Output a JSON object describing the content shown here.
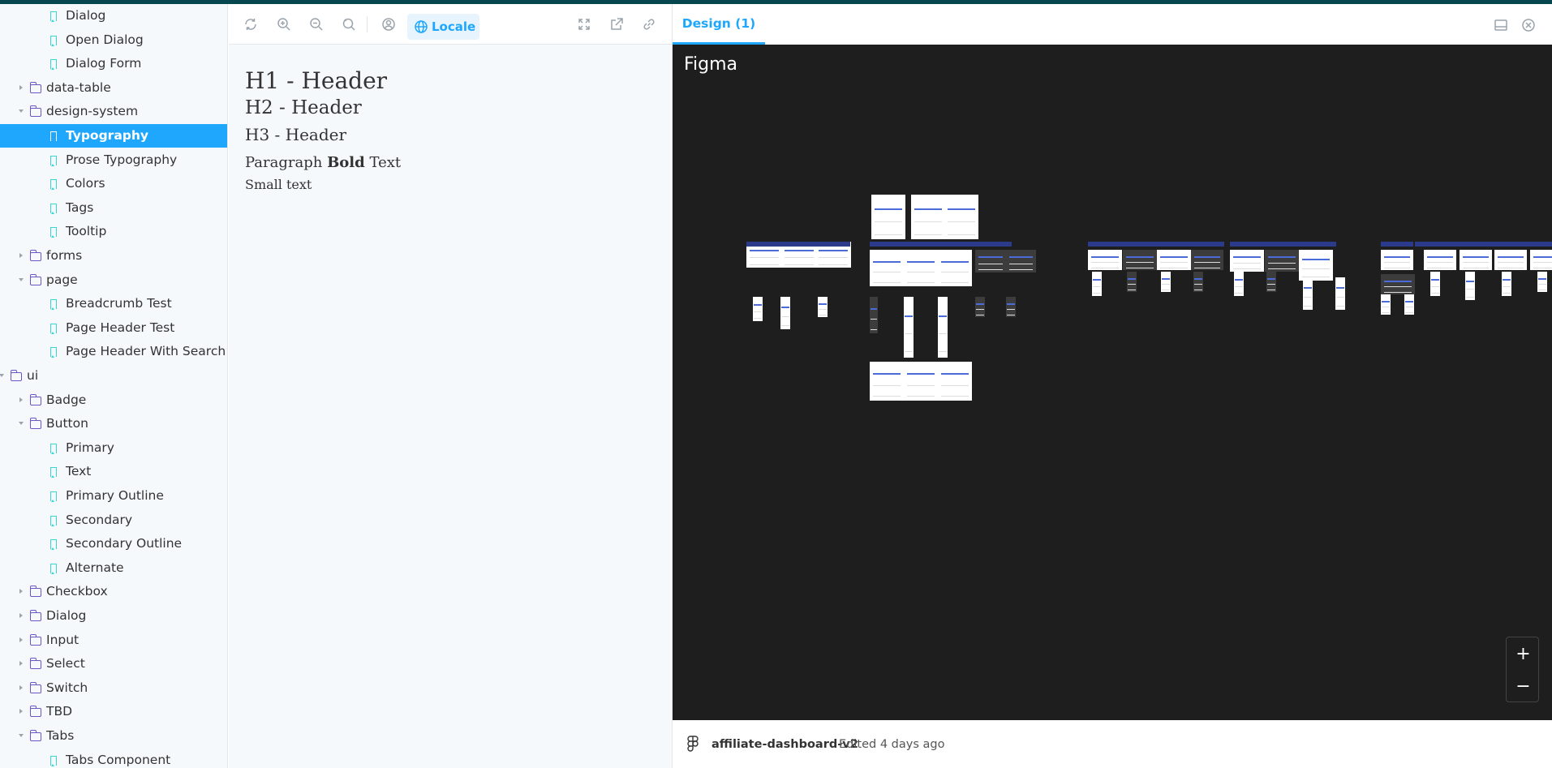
{
  "sidebar": {
    "items": [
      {
        "label": "Dialog",
        "type": "story",
        "depth": 2
      },
      {
        "label": "Open Dialog",
        "type": "story",
        "depth": 2
      },
      {
        "label": "Dialog Form",
        "type": "story",
        "depth": 2
      },
      {
        "label": "data-table",
        "type": "folder",
        "depth": 1,
        "expanded": false
      },
      {
        "label": "design-system",
        "type": "folder",
        "depth": 1,
        "expanded": true
      },
      {
        "label": "Typography",
        "type": "story",
        "depth": 2,
        "selected": true
      },
      {
        "label": "Prose Typography",
        "type": "story",
        "depth": 2
      },
      {
        "label": "Colors",
        "type": "story",
        "depth": 2
      },
      {
        "label": "Tags",
        "type": "story",
        "depth": 2
      },
      {
        "label": "Tooltip",
        "type": "story",
        "depth": 2
      },
      {
        "label": "forms",
        "type": "folder",
        "depth": 1,
        "expanded": false
      },
      {
        "label": "page",
        "type": "folder",
        "depth": 1,
        "expanded": true
      },
      {
        "label": "Breadcrumb Test",
        "type": "story",
        "depth": 2
      },
      {
        "label": "Page Header Test",
        "type": "story",
        "depth": 2
      },
      {
        "label": "Page Header With Search",
        "type": "story",
        "depth": 2
      },
      {
        "label": "ui",
        "type": "folder",
        "depth": 0,
        "expanded": true
      },
      {
        "label": "Badge",
        "type": "folder",
        "depth": 1,
        "expanded": false
      },
      {
        "label": "Button",
        "type": "folder",
        "depth": 1,
        "expanded": true
      },
      {
        "label": "Primary",
        "type": "story",
        "depth": 2
      },
      {
        "label": "Text",
        "type": "story",
        "depth": 2
      },
      {
        "label": "Primary Outline",
        "type": "story",
        "depth": 2
      },
      {
        "label": "Secondary",
        "type": "story",
        "depth": 2
      },
      {
        "label": "Secondary Outline",
        "type": "story",
        "depth": 2
      },
      {
        "label": "Alternate",
        "type": "story",
        "depth": 2
      },
      {
        "label": "Checkbox",
        "type": "folder",
        "depth": 1,
        "expanded": false
      },
      {
        "label": "Dialog",
        "type": "folder",
        "depth": 1,
        "expanded": false
      },
      {
        "label": "Input",
        "type": "folder",
        "depth": 1,
        "expanded": false
      },
      {
        "label": "Select",
        "type": "folder",
        "depth": 1,
        "expanded": false
      },
      {
        "label": "Switch",
        "type": "folder",
        "depth": 1,
        "expanded": false
      },
      {
        "label": "TBD",
        "type": "folder",
        "depth": 1,
        "expanded": false
      },
      {
        "label": "Tabs",
        "type": "folder",
        "depth": 1,
        "expanded": true
      },
      {
        "label": "Tabs Component",
        "type": "story",
        "depth": 2
      }
    ]
  },
  "toolbar": {
    "buttons": [
      "reload-icon",
      "zoom-in-icon",
      "zoom-out-icon",
      "zoom-reset-icon",
      "user-icon",
      "fullscreen-icon",
      "open-new-tab-icon",
      "link-icon"
    ],
    "locale_label": "Locale"
  },
  "preview": {
    "h1": "H1 - Header",
    "h2": "H2 - Header",
    "h3": "H3 - Header",
    "para_before": "Paragraph",
    "para_bold": "Bold",
    "para_after": "Text",
    "small": "Small text"
  },
  "design": {
    "tab_label": "Design (1)",
    "figma_label": "Figma",
    "zoom_in": "+",
    "zoom_out": "−",
    "file_name": "affiliate-dashboard-v2",
    "edited_text": "Edited 4 days ago"
  },
  "colors": {
    "accent": "#1ea7fd",
    "topbar": "#06464e",
    "folder": "#6b55c7",
    "story": "#37d5d3",
    "figma_bg": "#1e1e1e"
  }
}
